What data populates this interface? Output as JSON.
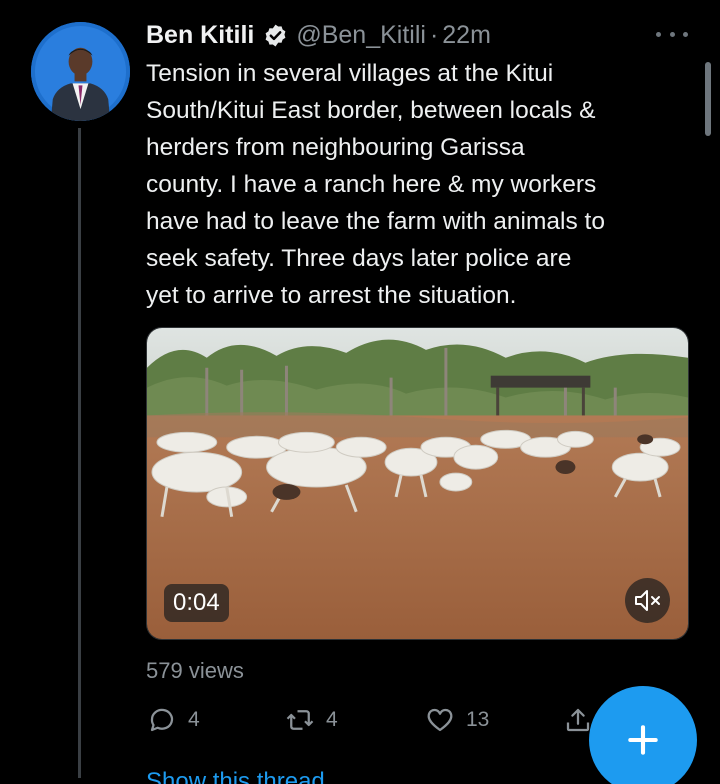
{
  "tweet": {
    "author_name": "Ben Kitili",
    "handle": "@Ben_Kitili",
    "separator": "·",
    "time": "22m",
    "text_lines": [
      "Tension in several villages at the Kitui",
      "South/Kitui East border, between locals &",
      "herders from neighbouring Garissa",
      "county. I have a ranch here & my workers",
      "have had to leave the farm with animals to",
      "seek safety. Three days later police are",
      "yet to arrive to arrest the situation."
    ],
    "video_timestamp": "0:04",
    "views": "579 views"
  },
  "actions": {
    "reply_count": "4",
    "retweet_count": "4",
    "like_count": "13"
  },
  "show_thread": "Show this thread",
  "icons": {
    "verified": "verified-badge-icon",
    "more": "more-dots-icon",
    "reply": "reply-icon",
    "retweet": "retweet-icon",
    "like": "heart-icon",
    "share": "share-icon",
    "mute": "volume-muted-icon",
    "compose": "plus-icon"
  },
  "colors": {
    "accent": "#1d9bf0",
    "background": "#000000",
    "text_primary": "#e7e9ea",
    "text_secondary": "#8b9298"
  }
}
